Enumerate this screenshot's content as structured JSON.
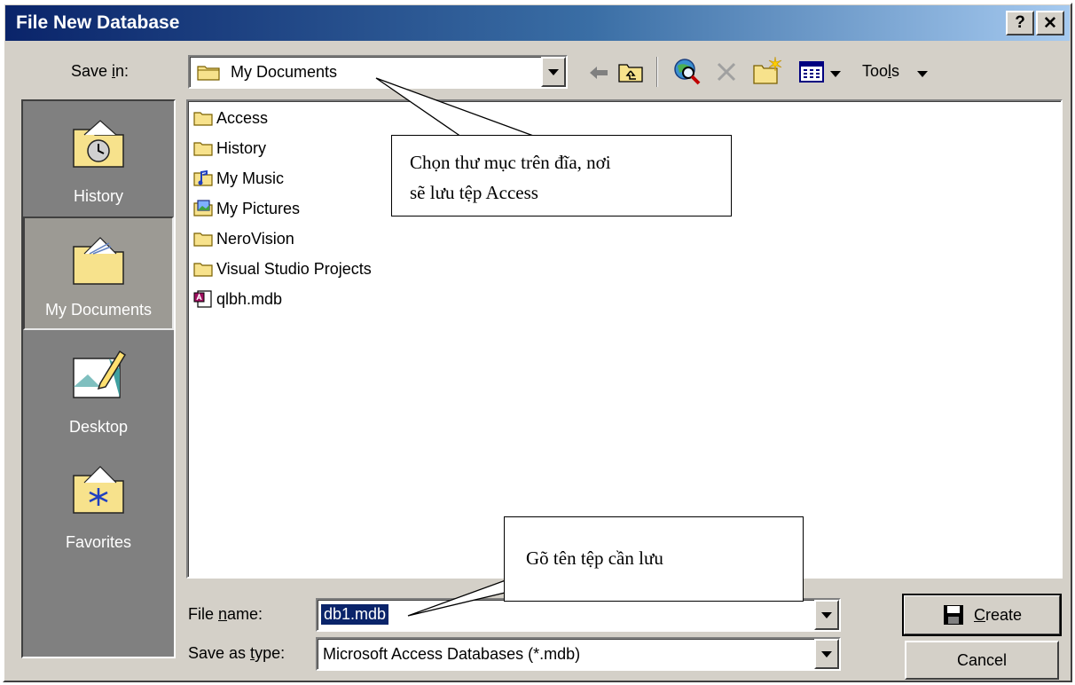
{
  "window": {
    "title": "File New Database",
    "help_label": "?",
    "close_label": "✕"
  },
  "save_in": {
    "label": "Save in:",
    "value": "My Documents",
    "folder_icon": "folder-icon"
  },
  "toolbar": {
    "back_icon": "back-arrow-icon",
    "up_icon": "up-one-level-icon",
    "search_icon": "search-web-icon",
    "delete_icon": "delete-icon",
    "new_folder_icon": "new-folder-icon",
    "views_icon": "views-icon",
    "tools_label": "Tools"
  },
  "places": [
    {
      "label": "History",
      "icon": "history-icon"
    },
    {
      "label": "My Documents",
      "icon": "my-documents-icon"
    },
    {
      "label": "Desktop",
      "icon": "desktop-icon"
    },
    {
      "label": "Favorites",
      "icon": "favorites-icon"
    }
  ],
  "files": [
    {
      "name": "Access",
      "icon": "folder-icon"
    },
    {
      "name": "History",
      "icon": "folder-icon"
    },
    {
      "name": "My Music",
      "icon": "music-folder-icon"
    },
    {
      "name": "My Pictures",
      "icon": "pictures-folder-icon"
    },
    {
      "name": "NeroVision",
      "icon": "folder-icon"
    },
    {
      "name": "Visual Studio Projects",
      "icon": "folder-icon"
    },
    {
      "name": "qlbh.mdb",
      "icon": "access-db-icon"
    }
  ],
  "file_name": {
    "label": "File name:",
    "value": "db1.mdb"
  },
  "save_as_type": {
    "label": "Save as type:",
    "value": "Microsoft Access Databases (*.mdb)"
  },
  "buttons": {
    "create": "Create",
    "cancel": "Cancel"
  },
  "callouts": {
    "top_line1": "Chọn thư mục trên đĩa, nơi",
    "top_line2": "sẽ lưu tệp Access",
    "bottom": "Gõ tên tệp cần lưu"
  },
  "colors": {
    "title_start": "#0a246a",
    "title_end": "#a6caf0",
    "dialog_bg": "#d4d0c8",
    "places_bg": "#808080",
    "selection": "#0a246a"
  }
}
